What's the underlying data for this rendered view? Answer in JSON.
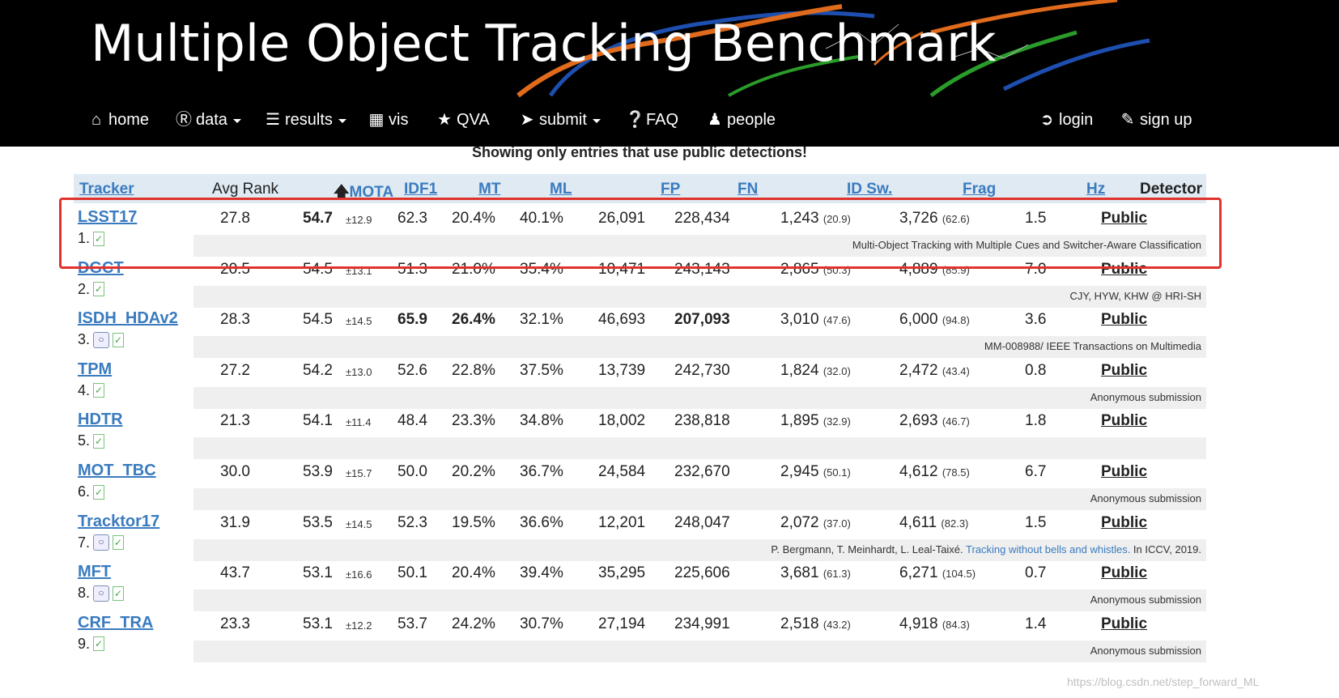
{
  "banner": {
    "title": "Multiple Object Tracking Benchmark"
  },
  "nav": {
    "home": "home",
    "data": "data",
    "results": "results",
    "vis": "vis",
    "qva": "QVA",
    "submit": "submit",
    "faq": "FAQ",
    "people": "people",
    "login": "login",
    "signup": "sign up"
  },
  "notice": "Showing only entries that use public detections!",
  "table": {
    "headers": {
      "tracker": "Tracker",
      "avg_rank": "Avg Rank",
      "mota": "MOTA",
      "idf1": "IDF1",
      "mt": "MT",
      "ml": "ML",
      "fp": "FP",
      "fn": "FN",
      "idsw": "ID Sw.",
      "frag": "Frag",
      "hz": "Hz",
      "detector": "Detector"
    },
    "rows": [
      {
        "name": "LSST17",
        "rank": "1.",
        "avg": "27.8",
        "mota": "54.7",
        "mota_sd": "±12.9",
        "idf1": "62.3",
        "mt": "20.4%",
        "ml": "40.1%",
        "fp": "26,091",
        "fn": "228,434",
        "idsw": "1,243",
        "idsw_r": "(20.9)",
        "frag": "3,726",
        "frag_r": "(62.6)",
        "hz": "1.5",
        "detector": "Public",
        "desc": "Multi-Object Tracking with Multiple Cues and Switcher-Aware Classification"
      },
      {
        "name": "DGCT",
        "rank": "2.",
        "avg": "20.5",
        "mota": "54.5",
        "mota_sd": "±13.1",
        "idf1": "51.3",
        "mt": "21.0%",
        "ml": "35.4%",
        "fp": "10,471",
        "fn": "243,143",
        "idsw": "2,865",
        "idsw_r": "(50.3)",
        "frag": "4,889",
        "frag_r": "(85.9)",
        "hz": "7.0",
        "detector": "Public",
        "desc": "CJY, HYW, KHW @ HRI-SH"
      },
      {
        "name": "ISDH_HDAv2",
        "rank": "3.",
        "avg": "28.3",
        "mota": "54.5",
        "mota_sd": "±14.5",
        "idf1": "65.9",
        "mt": "26.4%",
        "ml": "32.1%",
        "fp": "46,693",
        "fn": "207,093",
        "idsw": "3,010",
        "idsw_r": "(47.6)",
        "frag": "6,000",
        "frag_r": "(94.8)",
        "hz": "3.6",
        "detector": "Public",
        "desc": "MM-008988/ IEEE Transactions on Multimedia"
      },
      {
        "name": "TPM",
        "rank": "4.",
        "avg": "27.2",
        "mota": "54.2",
        "mota_sd": "±13.0",
        "idf1": "52.6",
        "mt": "22.8%",
        "ml": "37.5%",
        "fp": "13,739",
        "fn": "242,730",
        "idsw": "1,824",
        "idsw_r": "(32.0)",
        "frag": "2,472",
        "frag_r": "(43.4)",
        "hz": "0.8",
        "detector": "Public",
        "desc": "Anonymous submission"
      },
      {
        "name": "HDTR",
        "rank": "5.",
        "avg": "21.3",
        "mota": "54.1",
        "mota_sd": "±11.4",
        "idf1": "48.4",
        "mt": "23.3%",
        "ml": "34.8%",
        "fp": "18,002",
        "fn": "238,818",
        "idsw": "1,895",
        "idsw_r": "(32.9)",
        "frag": "2,693",
        "frag_r": "(46.7)",
        "hz": "1.8",
        "detector": "Public",
        "desc": ""
      },
      {
        "name": "MOT_TBC",
        "rank": "6.",
        "avg": "30.0",
        "mota": "53.9",
        "mota_sd": "±15.7",
        "idf1": "50.0",
        "mt": "20.2%",
        "ml": "36.7%",
        "fp": "24,584",
        "fn": "232,670",
        "idsw": "2,945",
        "idsw_r": "(50.1)",
        "frag": "4,612",
        "frag_r": "(78.5)",
        "hz": "6.7",
        "detector": "Public",
        "desc": "Anonymous submission"
      },
      {
        "name": "Tracktor17",
        "rank": "7.",
        "avg": "31.9",
        "mota": "53.5",
        "mota_sd": "±14.5",
        "idf1": "52.3",
        "mt": "19.5%",
        "ml": "36.6%",
        "fp": "12,201",
        "fn": "248,047",
        "idsw": "2,072",
        "idsw_r": "(37.0)",
        "frag": "4,611",
        "frag_r": "(82.3)",
        "hz": "1.5",
        "detector": "Public",
        "desc_pre": "P. Bergmann, T. Meinhardt, L. Leal-Taixé. ",
        "desc_link": "Tracking without bells and whistles.",
        "desc_post": " In ICCV, 2019."
      },
      {
        "name": "MFT",
        "rank": "8.",
        "avg": "43.7",
        "mota": "53.1",
        "mota_sd": "±16.6",
        "idf1": "50.1",
        "mt": "20.4%",
        "ml": "39.4%",
        "fp": "35,295",
        "fn": "225,606",
        "idsw": "3,681",
        "idsw_r": "(61.3)",
        "frag": "6,271",
        "frag_r": "(104.5)",
        "hz": "0.7",
        "detector": "Public",
        "desc": "Anonymous submission"
      },
      {
        "name": "CRF_TRA",
        "rank": "9.",
        "avg": "23.3",
        "mota": "53.1",
        "mota_sd": "±12.2",
        "idf1": "53.7",
        "mt": "24.2%",
        "ml": "30.7%",
        "fp": "27,194",
        "fn": "234,991",
        "idsw": "2,518",
        "idsw_r": "(43.2)",
        "frag": "4,918",
        "frag_r": "(84.3)",
        "hz": "1.4",
        "detector": "Public",
        "desc": "Anonymous submission"
      }
    ]
  },
  "watermark": "https://blog.csdn.net/step_forward_ML",
  "colors": {
    "link": "#3a7bbf",
    "header_bg": "#dfeaf3",
    "highlight": "#e0322b"
  }
}
